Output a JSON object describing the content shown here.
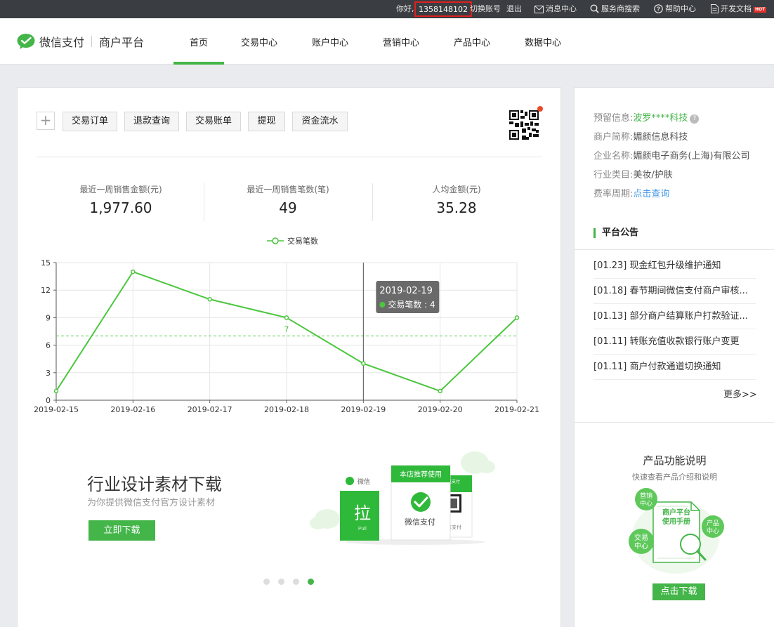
{
  "topbar": {
    "greeting": "你好,",
    "account": "1358148102",
    "switch": "切换账号",
    "logout": "退出",
    "messages": "消息中心",
    "search": "服务商搜索",
    "help": "帮助中心",
    "docs": "开发文档",
    "hot": "HOT"
  },
  "header": {
    "brand": "微信支付",
    "subtitle": "商户平台",
    "nav": [
      "首页",
      "交易中心",
      "账户中心",
      "营销中心",
      "产品中心",
      "数据中心"
    ],
    "active_nav": "首页"
  },
  "quick_actions": [
    "交易订单",
    "退款查询",
    "交易账单",
    "提现",
    "资金流水"
  ],
  "stats": [
    {
      "label": "最近一周销售金额(元)",
      "value": "1,977.60"
    },
    {
      "label": "最近一周销售笔数(笔)",
      "value": "49"
    },
    {
      "label": "人均金额(元)",
      "value": "35.28"
    }
  ],
  "chart_data": {
    "type": "line",
    "x": [
      "2019-02-15",
      "2019-02-16",
      "2019-02-17",
      "2019-02-18",
      "2019-02-19",
      "2019-02-20",
      "2019-02-21"
    ],
    "series": [
      {
        "name": "交易笔数",
        "values": [
          1,
          14,
          11,
          9,
          4,
          1,
          9
        ]
      }
    ],
    "yticks": [
      0,
      3,
      6,
      9,
      12,
      15
    ],
    "ylim": [
      0,
      15
    ],
    "average_line": {
      "value": 7,
      "label": "7"
    },
    "legend": "top-center",
    "grid": true,
    "tooltip": {
      "date": "2019-02-19",
      "text": "交易笔数 : 4",
      "index": 4
    },
    "color": "#4cc63f"
  },
  "banner": {
    "title": "行业设计素材下载",
    "subtitle": "为你提供微信支付官方设计素材",
    "button": "立即下载",
    "card_top": "本店推荐使用",
    "card_brand": "微信支付",
    "card_pull": "拉",
    "card_pull_sub": "Pull",
    "card_left_brand": "微信",
    "card_right_top": "使用微信支付",
    "card_right_bottom": "微信支付",
    "dots": 4,
    "active_dot": 3
  },
  "merchant_info": [
    {
      "label": "预留信息:",
      "value": "波罗****科技",
      "style": "green",
      "help": "?"
    },
    {
      "label": "商户简称:",
      "value": "媚颜信息科技",
      "style": "normal"
    },
    {
      "label": "企业名称:",
      "value": "媚颜电子商务(上海)有限公司",
      "style": "normal"
    },
    {
      "label": "行业类目:",
      "value": "美妆/护肤",
      "style": "normal"
    },
    {
      "label": "费率周期:",
      "value": "点击查询",
      "style": "blue"
    }
  ],
  "announcements": {
    "title": "平台公告",
    "items": [
      "[01.23] 现金红包升级维护通知",
      "[01.18] 春节期间微信支付商户审核...",
      "[01.13] 部分商户结算账户打款验证...",
      "[01.11] 转账充值收款银行账户变更",
      "[01.11] 商户付款通道切换通知"
    ],
    "more": "更多>>"
  },
  "product": {
    "title": "产品功能说明",
    "subtitle": "快速查看产品介绍和说明",
    "manual_line1": "商户平台",
    "manual_line2": "使用手册",
    "bubble_marketing": [
      "营销",
      "中心"
    ],
    "bubble_product": [
      "产品",
      "中心"
    ],
    "bubble_trade": [
      "交易",
      "中心"
    ],
    "button": "点击下载"
  }
}
